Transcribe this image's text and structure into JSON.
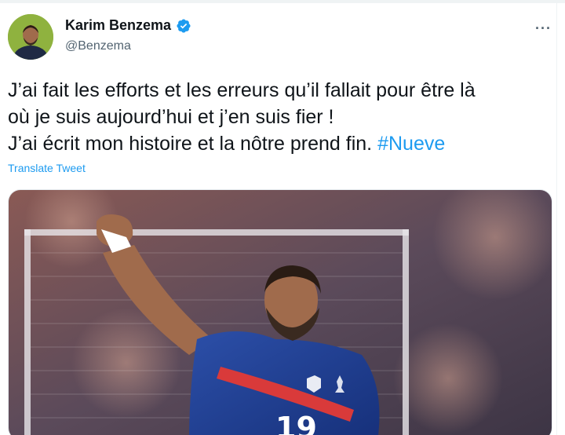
{
  "tweet": {
    "author_name": "Karim Benzema",
    "handle": "@Benzema",
    "text_line1": "J’ai fait les efforts et les erreurs qu’il fallait pour être là",
    "text_line2": "où je suis aujourd’hui et j’en suis fier !",
    "text_line3": "J’ai écrit mon histoire et la nôtre prend fin.",
    "hashtag": "#Nueve",
    "translate_label": "Translate Tweet",
    "more_label": "···"
  },
  "colors": {
    "accent": "#1d9bf0",
    "text": "#0f1419",
    "secondary": "#536471"
  },
  "icons": {
    "verified": "verified-badge-icon",
    "more": "more-options-icon"
  },
  "jersey_number": "19"
}
